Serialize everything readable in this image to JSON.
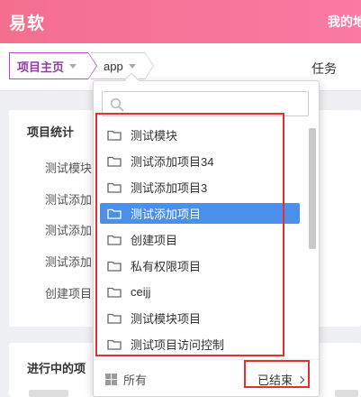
{
  "header": {
    "app_name": "易软",
    "right_link": "我的地盘"
  },
  "breadcrumb": {
    "home": "项目主页",
    "current": "app"
  },
  "tabs": {
    "task": "任务"
  },
  "stats_card": {
    "title": "项目统计",
    "items": [
      "测试模块",
      "测试添加",
      "测试添加",
      "测试添加",
      "创建项目"
    ]
  },
  "progress_card": {
    "title": "进行中的项"
  },
  "dropdown": {
    "search": {
      "value": "",
      "placeholder": ""
    },
    "items": [
      {
        "label": "测试模块",
        "selected": false
      },
      {
        "label": "测试添加项目34",
        "selected": false
      },
      {
        "label": "测试添加项目3",
        "selected": false
      },
      {
        "label": "测试添加项目",
        "selected": true
      },
      {
        "label": "创建项目",
        "selected": false
      },
      {
        "label": "私有权限项目",
        "selected": false
      },
      {
        "label": "ceijj",
        "selected": false
      },
      {
        "label": "测试模块项目",
        "selected": false
      },
      {
        "label": "测试项目访问控制",
        "selected": false
      }
    ],
    "footer": {
      "all_label": "所有",
      "ended_label": "已结束"
    }
  },
  "colors": {
    "header_gradient_start": "#f46f8e",
    "header_gradient_end": "#f87ba4",
    "breadcrumb_active": "#8e3aa8",
    "selected_item": "#4a8fea",
    "highlight_box": "#e03030"
  }
}
